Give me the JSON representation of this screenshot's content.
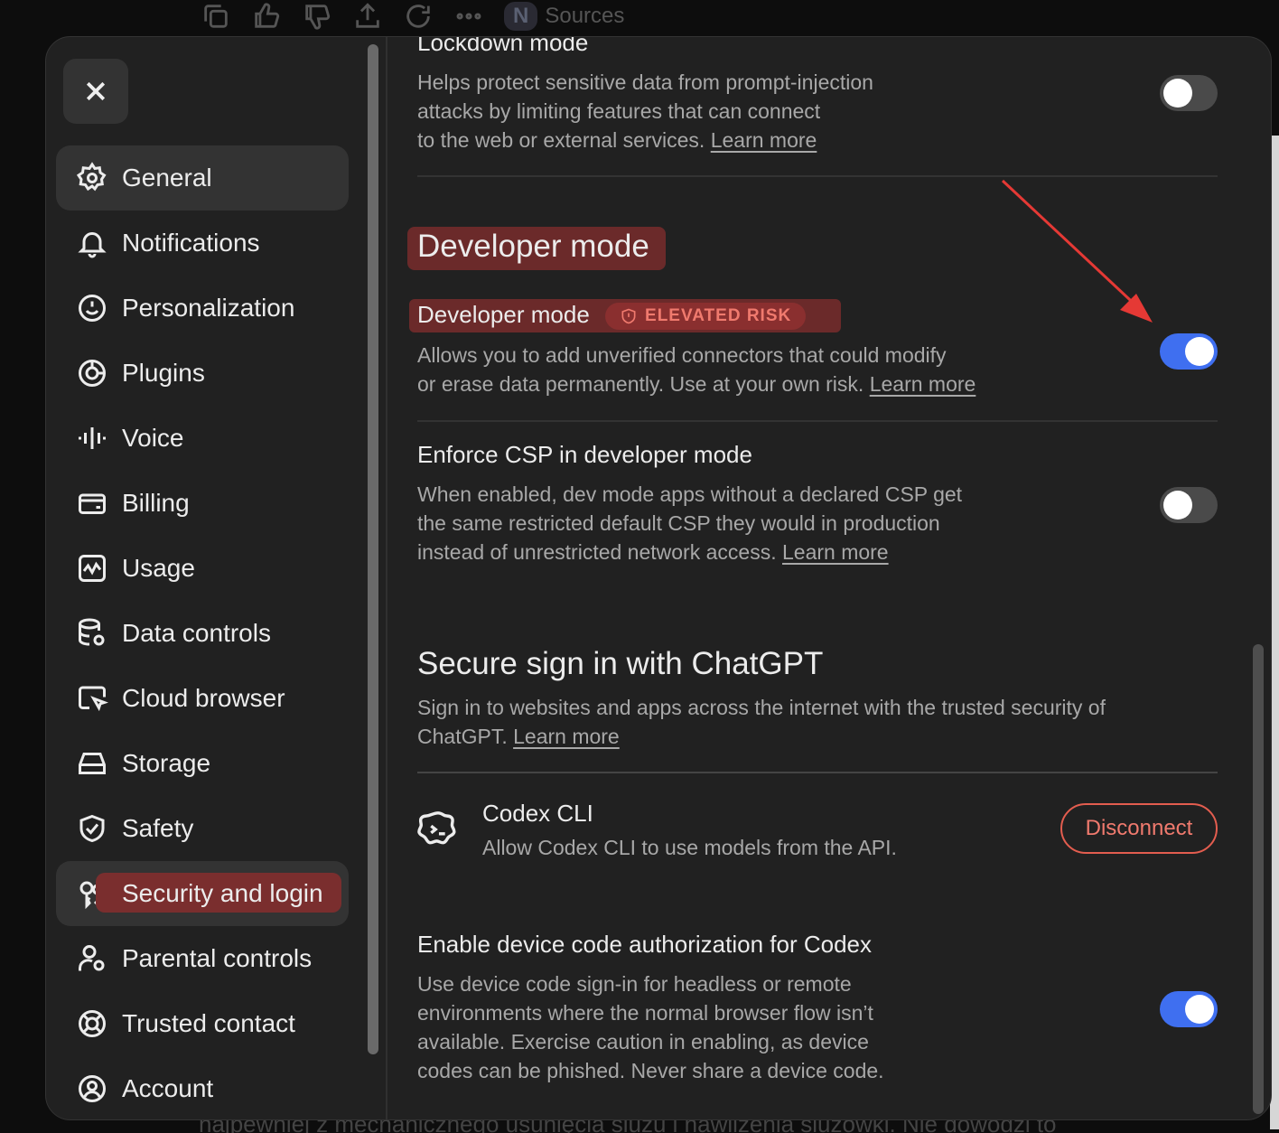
{
  "background": {
    "sources_label": "Sources",
    "sources_pill": "N",
    "bottom_text": "najpewniej z mechanicznego usunięcia śluzu i nawilżenia śluzówki. Nie dowodzi to"
  },
  "sidebar": {
    "items": [
      {
        "label": "General",
        "icon": "gear-icon"
      },
      {
        "label": "Notifications",
        "icon": "bell-icon"
      },
      {
        "label": "Personalization",
        "icon": "personalization-icon"
      },
      {
        "label": "Plugins",
        "icon": "plugins-icon"
      },
      {
        "label": "Voice",
        "icon": "waveform-icon"
      },
      {
        "label": "Billing",
        "icon": "card-icon"
      },
      {
        "label": "Usage",
        "icon": "usage-chart-icon"
      },
      {
        "label": "Data controls",
        "icon": "database-icon"
      },
      {
        "label": "Cloud browser",
        "icon": "cloud-browser-icon"
      },
      {
        "label": "Storage",
        "icon": "storage-icon"
      },
      {
        "label": "Safety",
        "icon": "shield-check-icon"
      },
      {
        "label": "Security and login",
        "icon": "keys-icon"
      },
      {
        "label": "Parental controls",
        "icon": "parental-icon"
      },
      {
        "label": "Trusted contact",
        "icon": "lifebuoy-icon"
      },
      {
        "label": "Account",
        "icon": "account-icon"
      }
    ]
  },
  "lockdown": {
    "title": "Lockdown mode",
    "desc_1": "Helps protect sensitive data from prompt-injection",
    "desc_2": "attacks by limiting features that can connect",
    "desc_3": "to the web or external services.",
    "link": "Learn more",
    "enabled": false
  },
  "developer": {
    "heading": "Developer mode",
    "title": "Developer mode",
    "badge": "ELEVATED RISK",
    "desc_1": "Allows you to add unverified connectors that could modify",
    "desc_2": "or erase data permanently. Use at your own risk.",
    "link": "Learn more",
    "enabled": true
  },
  "csp": {
    "title": "Enforce CSP in developer mode",
    "desc_1": "When enabled, dev mode apps without a declared CSP get",
    "desc_2": "the same restricted default CSP they would in production",
    "desc_3": "instead of unrestricted network access.",
    "link": "Learn more",
    "enabled": false
  },
  "secure_signin": {
    "heading": "Secure sign in with ChatGPT",
    "desc_1": "Sign in to websites and apps across the internet with the trusted security of",
    "desc_2": "ChatGPT.",
    "link": "Learn more"
  },
  "codex_cli": {
    "title": "Codex CLI",
    "desc": "Allow Codex CLI to use models from the API.",
    "button": "Disconnect"
  },
  "device_code": {
    "title": "Enable device code authorization for Codex",
    "desc_1": "Use device code sign-in for headless or remote",
    "desc_2": "environments where the normal browser flow isn’t",
    "desc_3": "available. Exercise caution in enabling, as device",
    "desc_4": "codes can be phished. Never share a device code.",
    "enabled": true
  },
  "colors": {
    "toggle_on": "#3f6ff0",
    "danger": "#e35d4f",
    "highlight": "#6b2a2a"
  }
}
